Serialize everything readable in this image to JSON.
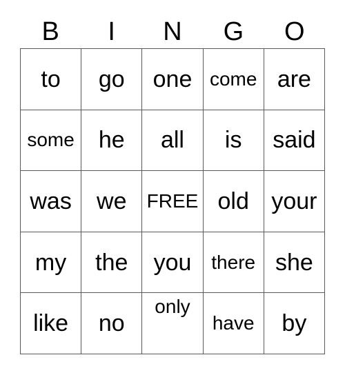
{
  "card": {
    "title": "BINGO",
    "headers": [
      "B",
      "I",
      "N",
      "G",
      "O"
    ],
    "grid": [
      [
        {
          "text": "to",
          "size": "normal",
          "align": "middle",
          "free": false
        },
        {
          "text": "go",
          "size": "normal",
          "align": "middle",
          "free": false
        },
        {
          "text": "one",
          "size": "normal",
          "align": "middle",
          "free": false
        },
        {
          "text": "come",
          "size": "small",
          "align": "middle",
          "free": false
        },
        {
          "text": "are",
          "size": "normal",
          "align": "middle",
          "free": false
        }
      ],
      [
        {
          "text": "some",
          "size": "small",
          "align": "middle",
          "free": false
        },
        {
          "text": "he",
          "size": "normal",
          "align": "middle",
          "free": false
        },
        {
          "text": "all",
          "size": "normal",
          "align": "middle",
          "free": false
        },
        {
          "text": "is",
          "size": "normal",
          "align": "middle",
          "free": false
        },
        {
          "text": "said",
          "size": "normal",
          "align": "middle",
          "free": false
        }
      ],
      [
        {
          "text": "was",
          "size": "normal",
          "align": "middle",
          "free": false
        },
        {
          "text": "we",
          "size": "normal",
          "align": "middle",
          "free": false
        },
        {
          "text": "FREE",
          "size": "small",
          "align": "middle",
          "free": true
        },
        {
          "text": "old",
          "size": "normal",
          "align": "middle",
          "free": false
        },
        {
          "text": "your",
          "size": "normal",
          "align": "middle",
          "free": false
        }
      ],
      [
        {
          "text": "my",
          "size": "normal",
          "align": "middle",
          "free": false
        },
        {
          "text": "the",
          "size": "normal",
          "align": "middle",
          "free": false
        },
        {
          "text": "you",
          "size": "normal",
          "align": "middle",
          "free": false
        },
        {
          "text": "there",
          "size": "small",
          "align": "middle",
          "free": false
        },
        {
          "text": "she",
          "size": "normal",
          "align": "middle",
          "free": false
        }
      ],
      [
        {
          "text": "like",
          "size": "normal",
          "align": "middle",
          "free": false
        },
        {
          "text": "no",
          "size": "normal",
          "align": "middle",
          "free": false
        },
        {
          "text": "only",
          "size": "small",
          "align": "top",
          "free": false
        },
        {
          "text": "have",
          "size": "small",
          "align": "middle",
          "free": false
        },
        {
          "text": "by",
          "size": "normal",
          "align": "middle",
          "free": false
        }
      ]
    ]
  },
  "colors": {
    "background": "#ffffff",
    "text": "#000000",
    "grid_line": "#595959"
  }
}
